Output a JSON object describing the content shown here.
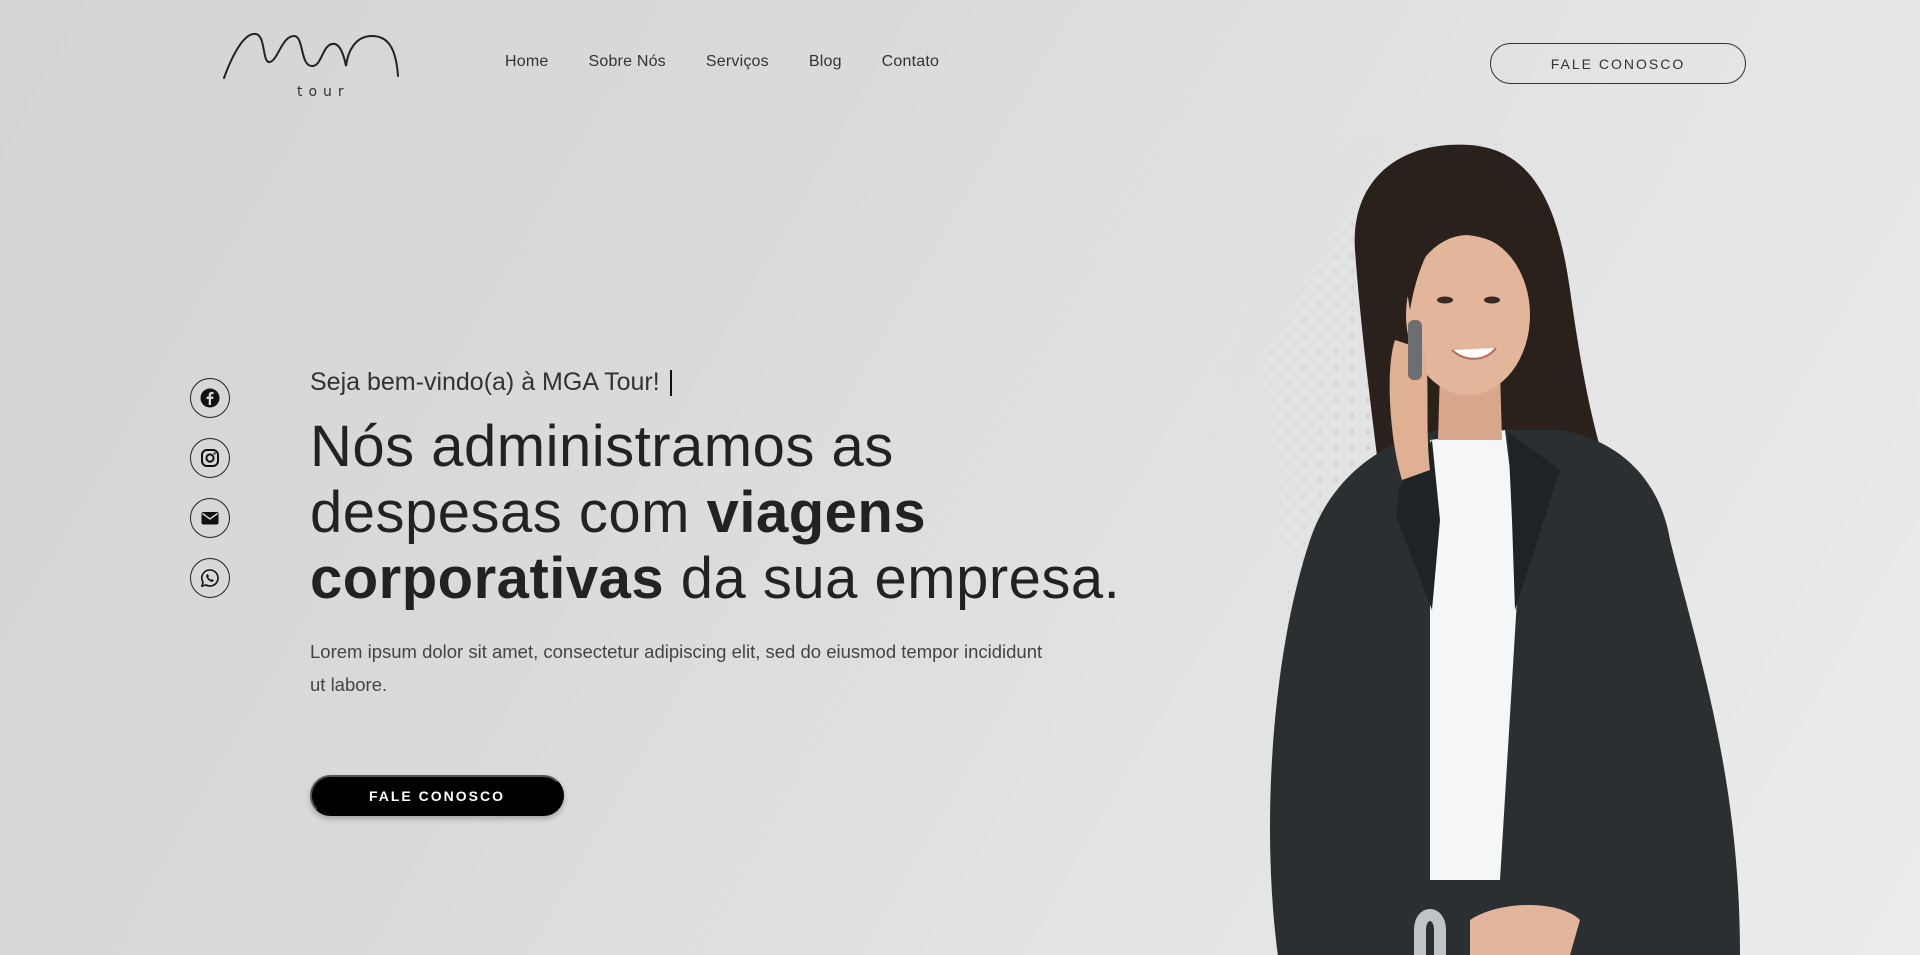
{
  "header": {
    "logo_text": "MGA",
    "logo_sub": "tour",
    "nav": [
      "Home",
      "Sobre Nós",
      "Serviços",
      "Blog",
      "Contato"
    ],
    "cta_label": "FALE CONOSCO"
  },
  "social": {
    "icons": [
      "facebook-icon",
      "instagram-icon",
      "email-icon",
      "whatsapp-icon"
    ]
  },
  "hero": {
    "welcome": "Seja bem-vindo(a) à MGA Tour!",
    "headline_part1": "Nós administramos as despesas com ",
    "headline_bold1": "viagens corporativas",
    "headline_part2": " da sua empresa.",
    "description": "Lorem ipsum dolor sit amet, consectetur adipiscing elit, sed do eiusmod tempor incididunt ut labore.",
    "cta_label": "FALE CONOSCO"
  },
  "colors": {
    "background": "#d8d8d8",
    "text": "#222222",
    "button_dark": "#000000"
  }
}
